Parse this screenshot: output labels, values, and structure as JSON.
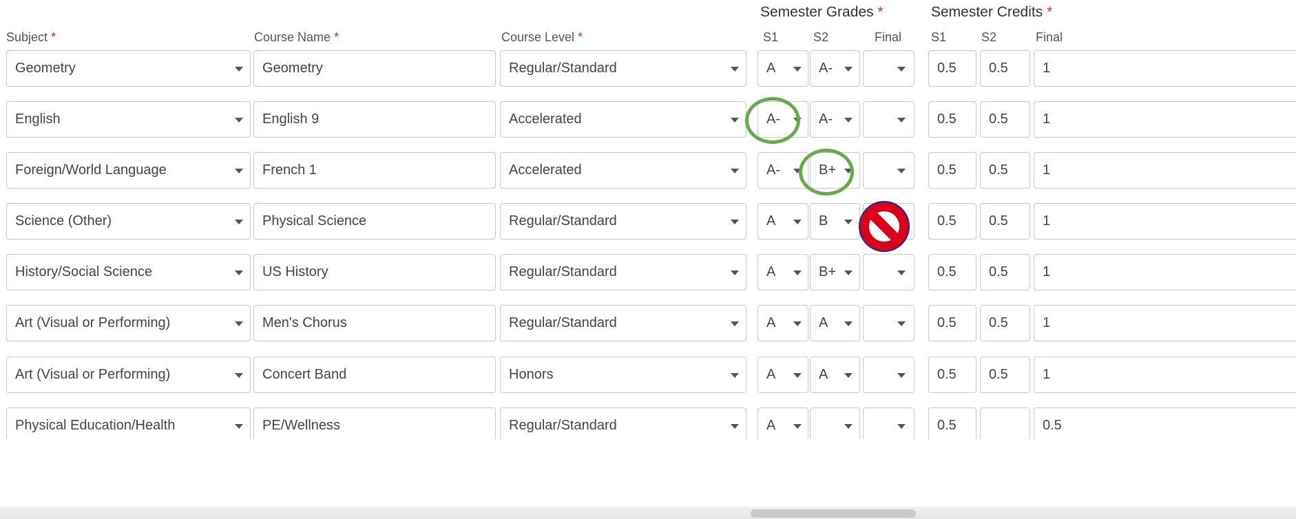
{
  "group_headers": {
    "semester_grades": "Semester Grades",
    "semester_credits": "Semester Credits",
    "required_marker": "*"
  },
  "columns": {
    "subject": "Subject",
    "course_name": "Course Name",
    "course_level": "Course Level",
    "s1": "S1",
    "s2": "S2",
    "final": "Final",
    "credit_s1": "S1",
    "credit_s2": "S2",
    "credit_final": "Final"
  },
  "rows": [
    {
      "subject": "Geometry",
      "course": "Geometry",
      "level": "Regular/Standard",
      "s1": "A",
      "s2": "A-",
      "final": "",
      "c1": "0.5",
      "c2": "0.5",
      "cf": "1"
    },
    {
      "subject": "English",
      "course": "English 9",
      "level": "Accelerated",
      "s1": "A-",
      "s2": "A-",
      "final": "",
      "c1": "0.5",
      "c2": "0.5",
      "cf": "1"
    },
    {
      "subject": "Foreign/World Language",
      "course": "French 1",
      "level": "Accelerated",
      "s1": "A-",
      "s2": "B+",
      "final": "",
      "c1": "0.5",
      "c2": "0.5",
      "cf": "1"
    },
    {
      "subject": "Science (Other)",
      "course": "Physical Science",
      "level": "Regular/Standard",
      "s1": "A",
      "s2": "B",
      "final": "",
      "c1": "0.5",
      "c2": "0.5",
      "cf": "1"
    },
    {
      "subject": "History/Social Science",
      "course": "US History",
      "level": "Regular/Standard",
      "s1": "A",
      "s2": "B+",
      "final": "",
      "c1": "0.5",
      "c2": "0.5",
      "cf": "1"
    },
    {
      "subject": "Art (Visual or Performing)",
      "course": "Men's Chorus",
      "level": "Regular/Standard",
      "s1": "A",
      "s2": "A",
      "final": "",
      "c1": "0.5",
      "c2": "0.5",
      "cf": "1"
    },
    {
      "subject": "Art (Visual or Performing)",
      "course": "Concert Band",
      "level": "Honors",
      "s1": "A",
      "s2": "A",
      "final": "",
      "c1": "0.5",
      "c2": "0.5",
      "cf": "1"
    },
    {
      "subject": "Physical Education/Health",
      "course": "PE/Wellness",
      "level": "Regular/Standard",
      "s1": "A",
      "s2": "",
      "final": "",
      "c1": "0.5",
      "c2": "",
      "cf": "0.5"
    }
  ],
  "annotations": {
    "highlight_color": "#6aa84f",
    "prohibited_color": "#d9001b",
    "prohibited_icon": "no-symbol-icon"
  }
}
